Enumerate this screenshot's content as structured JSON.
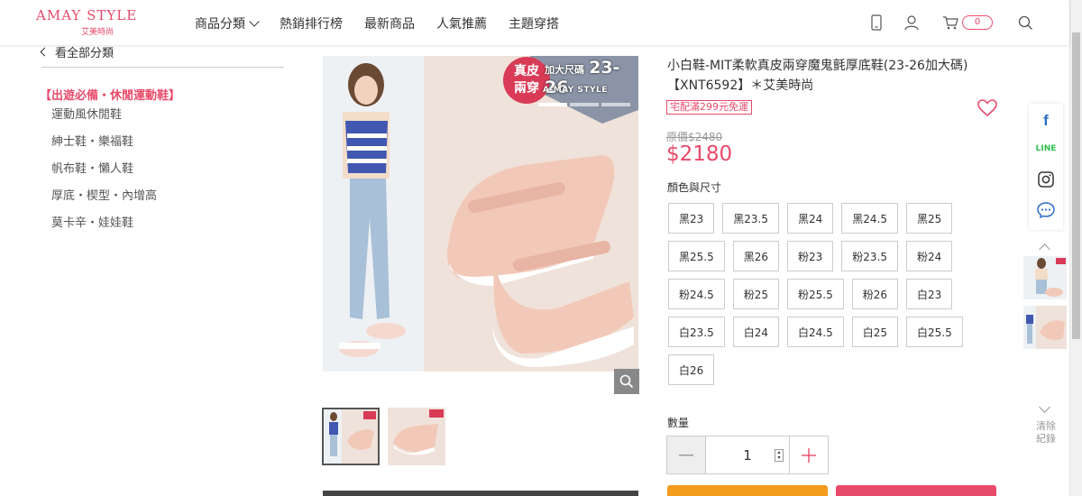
{
  "header": {
    "logo": {
      "text": "AMAY STYLE",
      "subtitle": "艾美時尚"
    },
    "nav": [
      "商品分類",
      "熱銷排行榜",
      "最新商品",
      "人氣推薦",
      "主題穿搭"
    ],
    "cart_count": "0",
    "icons": [
      "mobile-icon",
      "user-icon",
      "cart-icon",
      "search-icon"
    ],
    "accent": "#e84b6a"
  },
  "sidebar": {
    "back_label": "看全部分類",
    "category_title": "【出遊必備・休閒運動鞋】",
    "items": [
      "運動風休閒鞋",
      "紳士鞋・樂福鞋",
      "帆布鞋・懶人鞋",
      "厚底・楔型・內增高",
      "莫卡辛・娃娃鞋"
    ]
  },
  "gallery": {
    "badge": {
      "line1": "真皮",
      "line2": "兩穿"
    },
    "banner": {
      "prefix": "加大尺碼",
      "sizes": "23-26",
      "brand": "A-MAY STYLE"
    }
  },
  "product": {
    "title": "小白鞋-MIT柔軟真皮兩穿魔鬼氈厚底鞋(23-26加大碼)【XNT6592】＊艾美時尚",
    "shipping_tag": "宅配滿299元免運",
    "original_price": "原價$2480",
    "sale_price": "$2180",
    "options_label": "顏色與尺寸",
    "options": [
      [
        "黑23",
        "黑23.5",
        "黑24",
        "黑24.5",
        "黑25"
      ],
      [
        "黑25.5",
        "黑26",
        "粉23",
        "粉23.5",
        "粉24"
      ],
      [
        "粉24.5",
        "粉25",
        "粉25.5",
        "粉26",
        "白23"
      ],
      [
        "白23.5",
        "白24",
        "白24.5",
        "白25",
        "白25.5"
      ],
      [
        "白26"
      ]
    ],
    "quantity_label": "數量",
    "quantity": "1",
    "sale_color": "#e84b6a",
    "cart_button_color": "#f49b1d"
  },
  "right_rail": {
    "social": [
      "facebook-icon",
      "line-icon",
      "instagram-icon",
      "messenger-icon"
    ],
    "line_text": "LINE",
    "fb_text": "f",
    "clear_label": "清除紀錄"
  }
}
